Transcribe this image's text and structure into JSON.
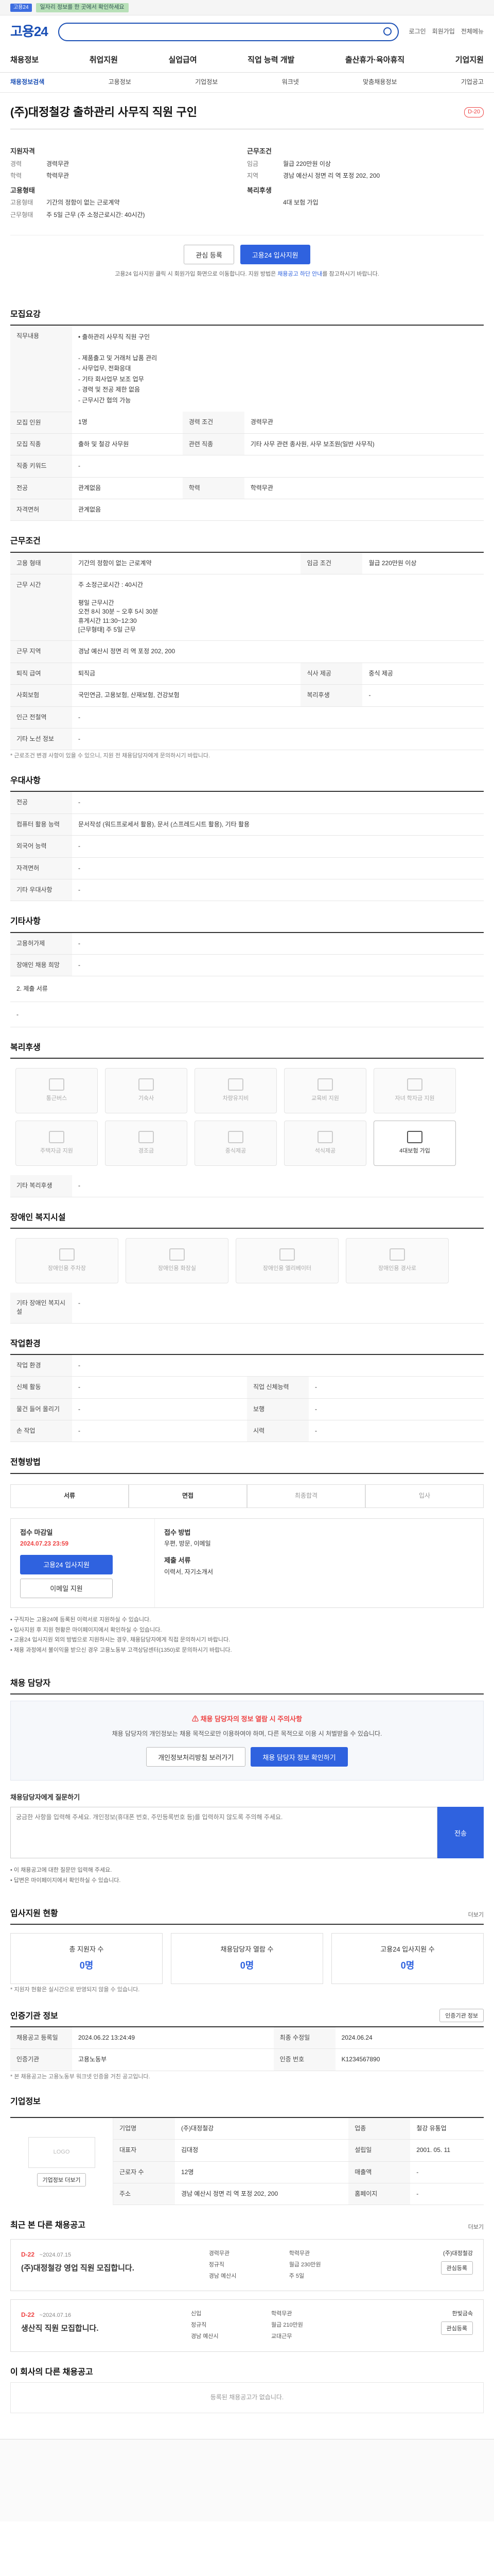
{
  "topbar": {
    "badge": "고용24",
    "message": "일자리 정보를 한 곳에서 확인하세요"
  },
  "header": {
    "logo": "고용24",
    "login": "로그인",
    "join": "회원가입",
    "sitemap": "전체메뉴"
  },
  "gnb": [
    "채용정보",
    "취업지원",
    "실업급여",
    "직업 능력 개발",
    "출산휴가·육아휴직",
    "기업지원"
  ],
  "subnav": [
    "채용정보검색",
    "고용정보",
    "기업정보",
    "워크넷",
    "맞춤채용정보",
    "기업공고"
  ],
  "job": {
    "title": "(주)대정철강 출하관리 사무직 직원 구인",
    "dday": "D-20"
  },
  "summary": {
    "left": {
      "title": "지원자격",
      "rows": [
        [
          "경력",
          "경력무관"
        ],
        [
          "학력",
          "학력무관"
        ]
      ],
      "emp_title": "고용형태",
      "emp_rows": [
        [
          "고용형태",
          "기간의 정함이 없는 근로계약"
        ],
        [
          "근무형태",
          "주 5일 근무 (주 소정근로시간: 40시간)"
        ]
      ]
    },
    "right": {
      "title": "근무조건",
      "rows": [
        [
          "임금",
          "월급 220만원 이상"
        ],
        [
          "지역",
          "경남 예산시 정면 리 역 포정 202, 200"
        ]
      ],
      "cond_title": "복리후생",
      "cond_rows": [
        [
          "",
          "4대 보험 가입"
        ]
      ]
    }
  },
  "actions": {
    "scrap": "관심 등록",
    "apply": "고용24 입사지원"
  },
  "notice": {
    "text": "고용24 입사지원 클릭 시 회원가입 화면으로 이동합니다. 지원 방법은 ",
    "em": "채용공고 하단 안내",
    "tail": "를 참고하시기 바랍니다."
  },
  "s_recruit": {
    "title": "모집요강",
    "subtitle": "직무내용",
    "desc": "• 출하관리 사무직 직원 구인\n\n- 제품출고 및 거래처 납품 관리\n- 사무업무, 전화응대\n- 기타 회사업무 보조 업무\n- 경력 및 전공 제한 없음\n- 근무시간 협의 가능",
    "rows": [
      [
        "모집 인원",
        "1명",
        "경력 조건",
        "경력무관"
      ],
      [
        "모집 직종",
        "출하 및 철강 사무원",
        "관련 직종",
        "기타 사무 관련 종사원, 사무 보조원(일반 사무직)"
      ],
      [
        "직종 키워드",
        "-",
        "",
        ""
      ],
      [
        "전공",
        "관계없음",
        "학력",
        "학력무관"
      ],
      [
        "자격면허",
        "관계없음",
        "",
        ""
      ]
    ]
  },
  "s_work": {
    "title": "근무조건",
    "rows": [
      [
        "고용 형태",
        "기간의 정함이 없는 근로계약",
        "임금 조건",
        "월급 220만원 이상"
      ],
      [
        "근무 시간",
        "주 소정근로시간 : 40시간\n\n평일 근무시간\n오전 8시 30분 ~ 오후 5시 30분\n휴게시간 11:30~12:30\n[근무형태] 주 5일 근무",
        "",
        ""
      ],
      [
        "근무 지역",
        "경남 예산시 정면 리 역 포정 202, 200",
        "",
        ""
      ],
      [
        "퇴직 급여",
        "퇴직금",
        "식사 제공",
        "중식 제공"
      ],
      [
        "사회보험",
        "국민연금, 고용보험, 산재보험, 건강보험",
        "복리후생",
        "-"
      ],
      [
        "인근 전철역",
        "-",
        "",
        ""
      ],
      [
        "기타 노선 정보",
        "-",
        "",
        ""
      ]
    ],
    "note": "* 근로조건 변경 사항이 있을 수 있으니, 지원 전 채용담당자에게 문의하시기 바랍니다."
  },
  "s_pref": {
    "title": "우대사항",
    "rows": [
      [
        "전공",
        "-"
      ],
      [
        "컴퓨터 활용 능력",
        "문서작성 (워드프로세서 활용), 문서 (스프레드시트 활용), 기타 활용"
      ],
      [
        "외국어 능력",
        "-"
      ],
      [
        "자격면허",
        "-"
      ],
      [
        "기타 우대사항",
        "-"
      ]
    ]
  },
  "s_etc": {
    "title": "기타사항",
    "rows": [
      [
        "고용허가제",
        "-"
      ],
      [
        "장애인 채용 희망",
        "-"
      ]
    ],
    "subtitle": "2. 제출 서류",
    "desc": "-"
  },
  "s_welfare": {
    "title": "복리후생",
    "items": [
      "통근버스",
      "기숙사",
      "차량유지비",
      "교육비 지원",
      "자녀 학자금 지원",
      "주택자금 지원",
      "경조금",
      "중식제공",
      "석식제공",
      "4대보험 가입"
    ],
    "on": [
      9
    ],
    "etc_title": "기타 복리후생",
    "etc_value": "-"
  },
  "s_disab": {
    "title": "장애인 복지시설",
    "items": [
      "장애인용 주차장",
      "장애인용 화장실",
      "장애인용 엘리베이터",
      "장애인용 경사로"
    ],
    "etc_title": "기타 장애인 복지시설",
    "etc_value": "-"
  },
  "s_workenv": {
    "title": "작업환경",
    "rows": [
      [
        "작업 환경",
        "-",
        "",
        ""
      ],
      [
        "신체 활동",
        "-",
        "직업 신체능력",
        "-"
      ],
      [
        "물건 들어 올리기",
        "-",
        "보행",
        "-"
      ],
      [
        "손 작업",
        "-",
        "시력",
        "-"
      ]
    ]
  },
  "s_proc": {
    "title": "전형방법",
    "steps": [
      "서류",
      "면접",
      "최종합격",
      "입사"
    ],
    "apply": {
      "period_label": "접수 마감일",
      "period": "2024.07.23 23:59",
      "btn_apply": "고용24 입사지원",
      "btn_email": "이메일 지원",
      "btn_fax": "FAX 지원",
      "method_label": "접수 방법",
      "method": "우편, 방문, 이메일",
      "docs_label": "제출 서류",
      "docs": "이력서, 자기소개서"
    },
    "bullets": [
      "• 구직자는 고용24에 등록된 이력서로 지원하실 수 있습니다.",
      "• 입사지원 후 지원 현황은 마이페이지에서 확인하실 수 있습니다.",
      "• 고용24 입사지원 외의 방법으로 지원하시는 경우, 채용담당자에게 직접 문의하시기 바랍니다.",
      "• 채용 과정에서 불이익을 받으신 경우 고용노동부 고객상담센터(1350)로 문의하시기 바랍니다."
    ]
  },
  "s_contact": {
    "title": "채용 담당자",
    "warn": "채용 담당자의 정보 열람 시 주의사항",
    "desc": "채용 담당자의 개인정보는 채용 목적으로만 이용하여야 하며, 다른 목적으로 이용 시 처벌받을 수 있습니다.",
    "b1": "개인정보처리방침 보러가기",
    "b2": "채용 담당자 정보 확인하기"
  },
  "s_qa": {
    "title": "채용담당자에게 질문하기",
    "placeholder": "궁금한 사항을 입력해 주세요. 개인정보(휴대폰 번호, 주민등록번호 등)를 입력하지 않도록 주의해 주세요.",
    "btn": "전송",
    "notes": [
      "• 이 채용공고에 대한 질문만 입력해 주세요.",
      "• 답변은 마이페이지에서 확인하실 수 있습니다."
    ]
  },
  "s_stats": {
    "title": "입사지원 현황",
    "more": "더보기",
    "items": [
      [
        "총 지원자 수",
        "0명"
      ],
      [
        "채용담당자 열람 수",
        "0명"
      ],
      [
        "고용24 입사지원 수",
        "0명"
      ]
    ],
    "note": "* 지원자 현황은 실시간으로 반영되지 않을 수 있습니다."
  },
  "s_history": {
    "title": "인증기관 정보",
    "btn": "인증기관 정보",
    "rows": [
      [
        "채용공고 등록일",
        "2024.06.22 13:24:49",
        "최종 수정일",
        "2024.06.24"
      ],
      [
        "인증기관",
        "고용노동부",
        "인증 번호",
        "K1234567890"
      ]
    ],
    "note": "* 본 채용공고는 고용노동부 워크넷 인증을 거친 공고입니다."
  },
  "s_company": {
    "title": "기업정보",
    "logo": "LOGO",
    "btn": "기업정보 더보기",
    "rows": [
      [
        "기업명",
        "(주)대정철강",
        "업종",
        "철강 유통업"
      ],
      [
        "대표자",
        "김대정",
        "설립일",
        "2001. 05. 11"
      ],
      [
        "근로자 수",
        "12명",
        "매출액",
        "-"
      ],
      [
        "주소",
        "경남 예산시 정면 리 역 포정 202, 200",
        "홈페이지",
        "-"
      ]
    ]
  },
  "s_recent": {
    "title": "최근 본 다른 채용공고",
    "more": "더보기",
    "cards": [
      {
        "dday": "D-22",
        "date": "~2024.07.15",
        "title": "(주)대정철강 영업 직원 모집합니다.",
        "tags": [
          "경력무관",
          "학력무관",
          "정규직",
          "월급 230만원",
          "경남 예산시",
          "주 5일"
        ],
        "company": "(주)대정철강",
        "btn": "관심등록"
      },
      {
        "dday": "D-22",
        "date": "~2024.07.16",
        "title": "생산직 직원 모집합니다.",
        "tags": [
          "신입",
          "학력무관",
          "정규직",
          "월급 210만원",
          "경남 예산시",
          "교대근무"
        ],
        "company": "한빛금속",
        "btn": "관심등록"
      }
    ]
  },
  "s_jobs": {
    "title": "이 회사의 다른 채용공고",
    "empty": "등록된 채용공고가 없습니다."
  }
}
